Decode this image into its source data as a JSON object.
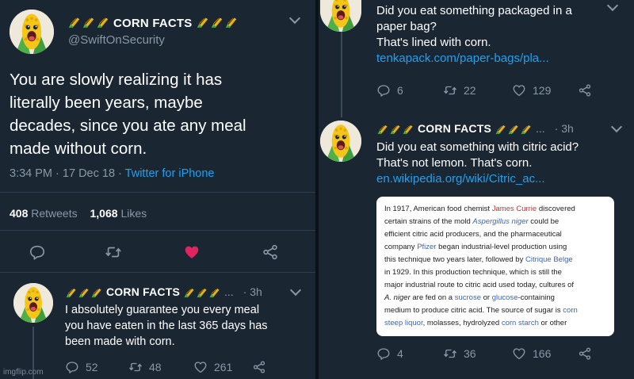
{
  "account": {
    "name": "CORN FACTS",
    "handle": "@SwiftOnSecurity"
  },
  "main_tweet": {
    "text_lines": [
      "You are slowly realizing it has",
      "literally been years, maybe",
      "decades, since you ate any meal",
      "made without corn."
    ],
    "time": "3:34 PM",
    "sep": "·",
    "date": "17 Dec 18",
    "source": "Twitter for iPhone",
    "retweets_count": "408",
    "retweets_label": "Retweets",
    "likes_count": "1,068",
    "likes_label": "Likes"
  },
  "reply_tweet": {
    "name": "CORN FACTS",
    "ellipsis": "...",
    "age": "· 3h",
    "text_lines": [
      "I absolutely guarantee you every meal",
      "you have eaten in the last 365 days has",
      "been made with corn."
    ],
    "replies": "52",
    "retweets": "48",
    "likes": "261"
  },
  "paper_tweet": {
    "text_lines": [
      "Did you eat something packaged in a",
      "paper bag?",
      "That's lined with corn."
    ],
    "link": "tenkapack.com/paper-bags/pla...",
    "replies": "6",
    "retweets": "22",
    "likes": "129"
  },
  "citric_tweet": {
    "name": "CORN FACTS",
    "ellipsis": "...",
    "age": "· 3h",
    "text_lines": [
      "Did you eat something with citric acid?",
      "That's not lemon. That's corn."
    ],
    "link": "en.wikipedia.org/wiki/Citric_ac...",
    "replies": "4",
    "retweets": "36",
    "likes": "166"
  },
  "wiki_excerpt": {
    "l1a": "In 1917, American food chemist ",
    "l1b": "James Currie",
    "l1c": " discovered",
    "l2a": "certain strains of the mold ",
    "l2b": "Aspergillus niger",
    "l2c": " could be",
    "l3": "efficient citric acid producers, and the pharmaceutical",
    "l4a": "company ",
    "l4b": "Pfizer",
    "l4c": " began industrial-level production using",
    "l5a": "this technique two years later, followed by ",
    "l5b": "Citrique Belge",
    "l6": "in 1929. In this production technique, which is still the",
    "l7": "major industrial route to citric acid used today, cultures of",
    "l8a": "A. niger",
    "l8b": " are fed on a ",
    "l8c": "sucrose",
    "l8d": " or ",
    "l8e": "glucose",
    "l8f": "-containing",
    "l9a": "medium to produce citric acid. The source of sugar is ",
    "l9b": "corn",
    "l10a": "steep liquor",
    "l10b": ", molasses, hydrolyzed ",
    "l10c": "corn starch",
    "l10d": " or other"
  },
  "colors": {
    "background": "#1b2633",
    "muted": "#8899a6",
    "link": "#1da1f2",
    "like_active": "#e0245e"
  },
  "icons": [
    "corn-icon",
    "reply-icon",
    "retweet-icon",
    "heart-icon",
    "share-icon",
    "chevron-down-icon"
  ],
  "watermark": "imgflip.com"
}
